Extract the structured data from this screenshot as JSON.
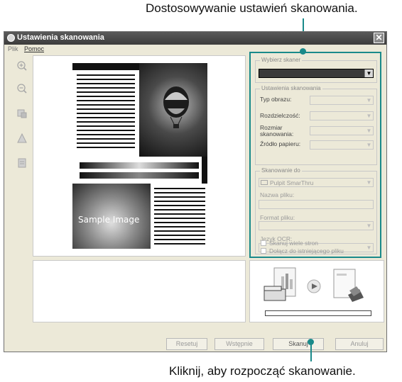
{
  "callouts": {
    "top": "Dostosowywanie ustawień skanowania.",
    "bottom": "Kliknij, aby rozpocząć skanowanie."
  },
  "window": {
    "title": "Ustawienia skanowania",
    "close_glyph": "✕"
  },
  "menu": {
    "file": "Plik",
    "help": "Pomoc"
  },
  "toolbar": {
    "icons": [
      "zoom-in-icon",
      "zoom-out-icon",
      "select-area-icon",
      "rotate-icon",
      "page-icon"
    ]
  },
  "preview": {
    "sample_text": "Sample Image"
  },
  "scanner_group": {
    "title": "Wybierz skaner",
    "selected": ""
  },
  "settings_group": {
    "title": "Ustawienia skanowania",
    "image_type_label": "Typ obrazu:",
    "resolution_label": "Rozdzielczość:",
    "scan_size_label": "Rozmiar skanowania:",
    "paper_source_label": "Źródło papieru:"
  },
  "scan_to_group": {
    "title": "Skanowanie do",
    "destination": "Pulpit SmarThru",
    "file_name_label": "Nazwa pliku:",
    "file_name_value": "",
    "file_format_label": "Format pliku:",
    "ocr_language_label": "Język OCR:",
    "scan_multiple_label": "Skanuj wiele stron",
    "append_label": "Dołącz do istniejącego pliku"
  },
  "buttons": {
    "reset": "Resetuj",
    "prescan": "Wstępnie",
    "scan": "Skanuj",
    "cancel": "Anuluj"
  },
  "colors": {
    "accent": "#1a8a8a"
  }
}
